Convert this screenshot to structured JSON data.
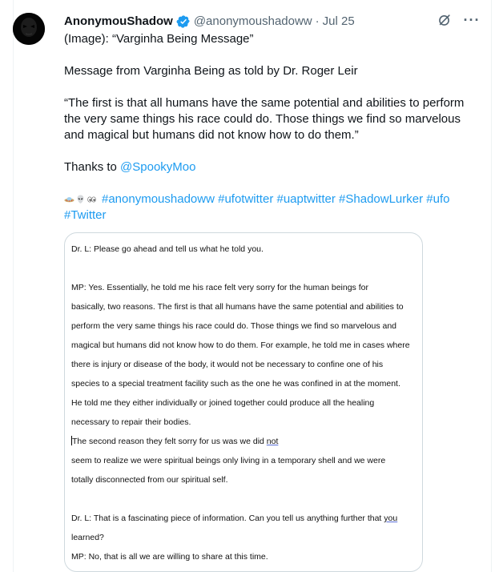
{
  "tweet": {
    "display_name": "AnonymouShadow",
    "handle": "@anonymoushadoww",
    "separator": "·",
    "date": "Jul 25",
    "more_label": "···",
    "line_image": "(Image): “Varginha Being Message”",
    "line_intro": "Message from Varginha Being as told by Dr. Roger Leir",
    "quote": "“The first is that all humans have the same potential and abilities to perform the very same things his race could do. Those things we find so marvelous and magical but humans did not know how to do them.”",
    "thanks_prefix": "Thanks to ",
    "thanks_mention": "@SpookyMoo",
    "hashtags": [
      "#anonymoushadoww",
      "#ufotwitter",
      "#uaptwitter",
      "#ShadowLurker",
      "#ufo",
      "#Twitter"
    ],
    "icons": [
      "verified-badge-icon",
      "grok-icon",
      "more-icon",
      "ufo-emoji",
      "alien-emoji",
      "eyes-emoji"
    ],
    "colors": {
      "link": "#1d9bf0",
      "verified": "#1d9bf0",
      "muted": "#536471"
    }
  },
  "document": {
    "l1": "Dr. L: Please go ahead and tell us what he told you.",
    "l2": "MP: Yes. Essentially, he told me his race felt very sorry for the human beings for",
    "l3": "basically, two reasons. The first is that all humans have the same potential and abilities to",
    "l4": "perform the very same things his race could do. Those things we find so marvelous and",
    "l5": "magical but humans did not know how to do them. For example, he told me in cases where",
    "l6": "there is injury or disease of the body, it would not be necessary to confine one of his",
    "l7": "species to a special treatment facility such as the one he was confined in at the moment.",
    "l8": "He told me they either individually or joined together could produce all the healing",
    "l9": "necessary to repair their bodies.",
    "l10a": "The second reason they felt sorry for us was we did ",
    "l10b": "not",
    "l11": "seem to realize we were spiritual beings only living in a temporary shell and we were",
    "l12": "totally disconnected from our spiritual self.",
    "l13a": "Dr. L: That is a fascinating piece of information. Can you tell us anything further that ",
    "l13b": "you",
    "l14": "learned?",
    "l15": "MP: No, that is all we are willing to share at this time."
  }
}
